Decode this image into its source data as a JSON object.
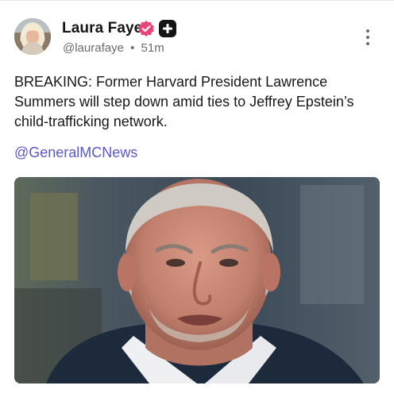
{
  "author": {
    "display_name": "Laura Faye",
    "handle": "@laurafaye",
    "separator": "•",
    "time_ago": "51m",
    "avatar_icon": "user-avatar",
    "verified_icon": "verified-badge-icon",
    "verified_color": "#e8447a",
    "plus_icon": "plus-badge-icon"
  },
  "menu": {
    "icon": "more-vertical-icon"
  },
  "post": {
    "text": "BREAKING: Former Harvard President Lawrence Summers will step down amid ties to Jeffrey Epstein’s child-trafficking network.",
    "mention": "@GeneralMCNews",
    "mention_color": "#5b58c9"
  }
}
